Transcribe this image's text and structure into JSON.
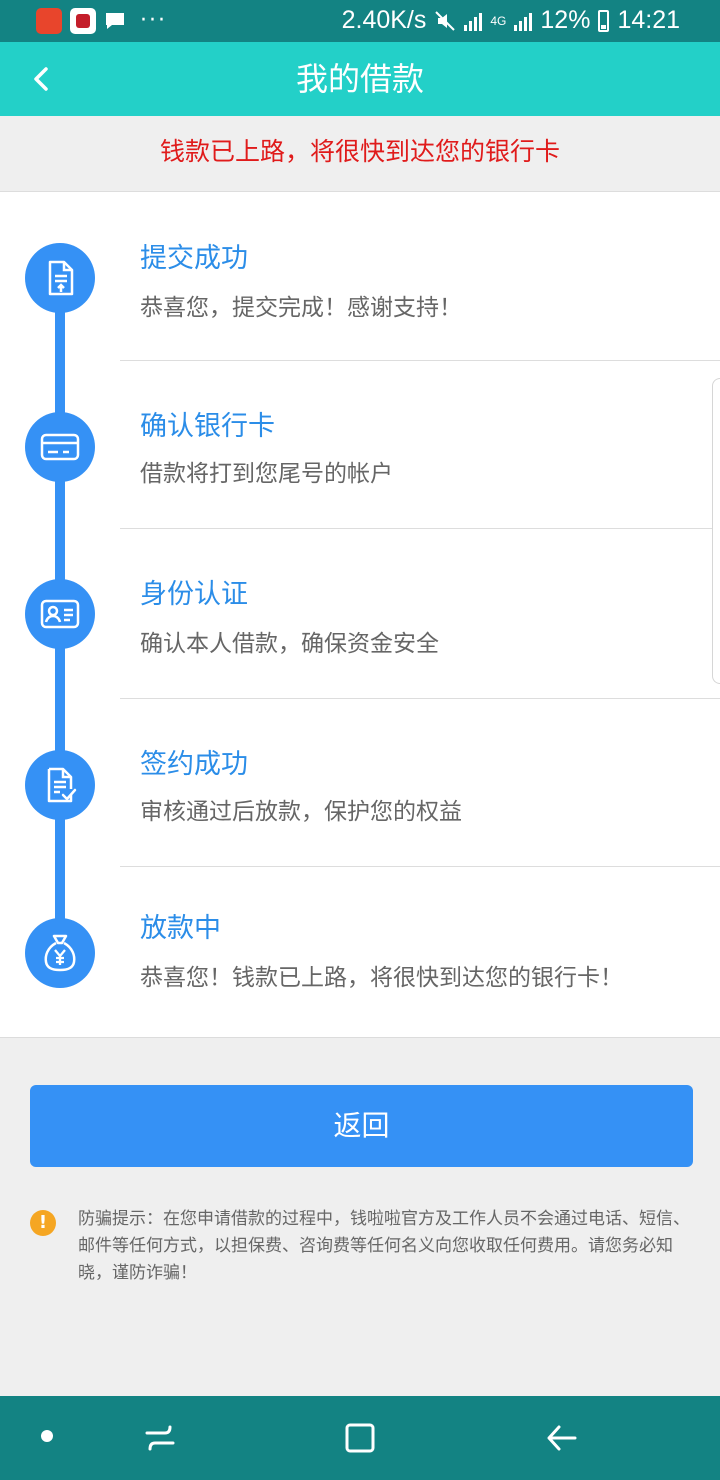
{
  "status_bar": {
    "dots": "···",
    "network_speed": "2.40K/s",
    "network_type": "4G",
    "battery": "12%",
    "time": "14:21"
  },
  "header": {
    "title": "我的借款"
  },
  "notice": {
    "text": "钱款已上路，将很快到达您的银行卡"
  },
  "steps": [
    {
      "title": "提交成功",
      "desc": "恭喜您，提交完成！感谢支持！",
      "icon": "document-upload-icon"
    },
    {
      "title": "确认银行卡",
      "desc": "借款将打到您尾号的帐户",
      "icon": "bank-card-icon"
    },
    {
      "title": "身份认证",
      "desc": "确认本人借款，确保资金安全",
      "icon": "id-card-icon"
    },
    {
      "title": "签约成功",
      "desc": "审核通过后放款，保护您的权益",
      "icon": "contract-check-icon"
    },
    {
      "title": "放款中",
      "desc": "恭喜您！钱款已上路，将很快到达您的银行卡！",
      "icon": "money-bag-icon"
    }
  ],
  "return_button": {
    "label": "返回"
  },
  "tip": {
    "text": "防骗提示：在您申请借款的过程中，钱啦啦官方及工作人员不会通过电话、短信、邮件等任何方式，以担保费、咨询费等任何名义向您收取任何费用。请您务必知晓，谨防诈骗！"
  },
  "colors": {
    "status_bar": "#138383",
    "header": "#23d0c8",
    "accent_blue": "#3591f5",
    "notice_red": "#e01b1b",
    "warning_orange": "#f5a623"
  }
}
